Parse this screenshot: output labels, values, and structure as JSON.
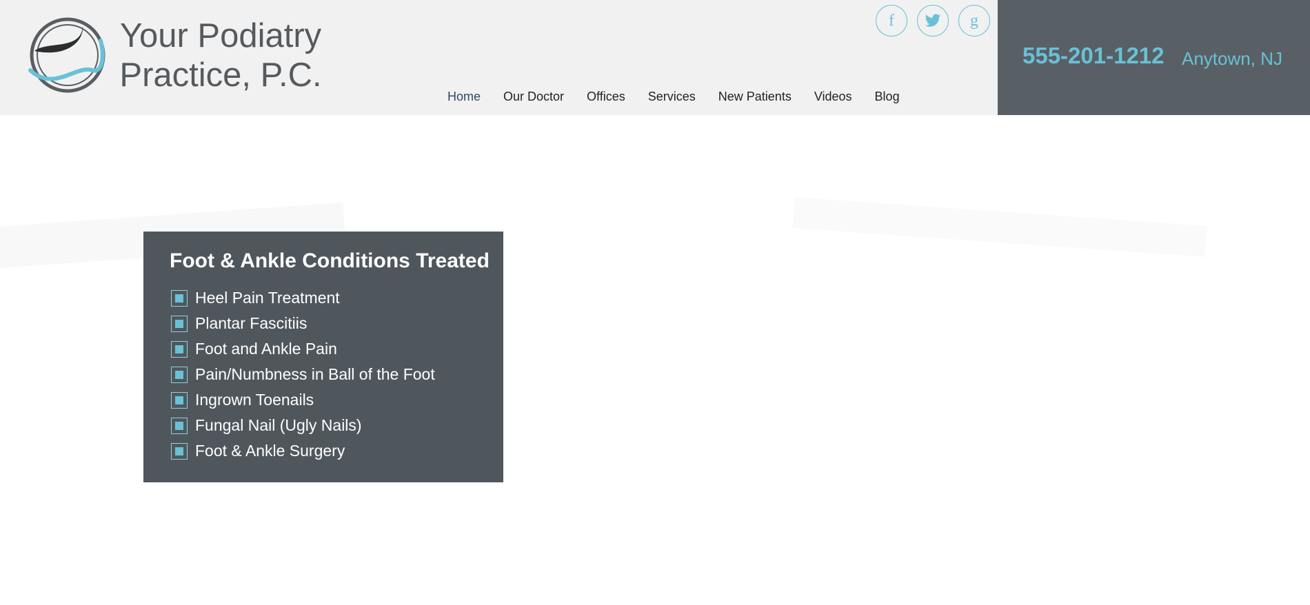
{
  "brand": {
    "name_line1": "Your Podiatry",
    "name_line2": "Practice, P.C."
  },
  "social": [
    {
      "icon": "facebook-icon",
      "glyph": "f"
    },
    {
      "icon": "twitter-icon",
      "glyph": "🐦"
    },
    {
      "icon": "google-plus-icon",
      "glyph": "g"
    }
  ],
  "nav": {
    "items": [
      {
        "label": "Home",
        "active": true
      },
      {
        "label": "Our Doctor"
      },
      {
        "label": "Offices"
      },
      {
        "label": "Services"
      },
      {
        "label": "New Patients"
      },
      {
        "label": "Videos"
      },
      {
        "label": "Blog"
      }
    ]
  },
  "contact": {
    "phone": "555-201-1212",
    "location": "Anytown, NJ"
  },
  "conditions": {
    "title": "Foot & Ankle Conditions Treated",
    "items": [
      "Heel Pain Treatment",
      "Plantar Fascitiis",
      "Foot and Ankle Pain",
      "Pain/Numbness in Ball of the Foot",
      "Ingrown Toenails",
      "Fungal Nail (Ugly Nails)",
      "Foot & Ankle Surgery"
    ]
  },
  "colors": {
    "accent": "#69c1d6",
    "header_bg": "#f1f1f1",
    "contact_bg": "#596065",
    "panel_bg": "#50575c"
  }
}
